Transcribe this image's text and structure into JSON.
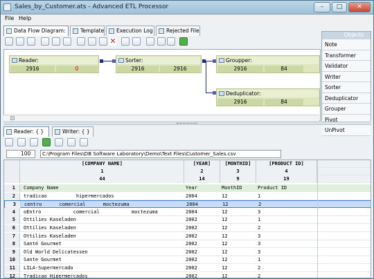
{
  "window": {
    "title": "Sales_by_Customer.ats - Advanced ETL Processor",
    "minimize": "–",
    "maximize": "□",
    "close": "✕"
  },
  "menu": {
    "file": "File",
    "help": "Help"
  },
  "tabs_top": [
    "Data Flow Diagram:",
    "Template",
    "Execution Log",
    "Rejected File"
  ],
  "objects_panel": {
    "title": "Objects",
    "items": [
      "Note",
      "Transformer",
      "Validator",
      "Writer",
      "Sorter",
      "Deduplicator",
      "Grouper",
      "Pivot",
      "UnPivot"
    ]
  },
  "nodes": {
    "reader": {
      "label": "Reader:",
      "v1": "2916",
      "v2": "0"
    },
    "sorter": {
      "label": "Sorter:",
      "v1": "2916",
      "v2": "2916"
    },
    "groupper": {
      "label": "Groupper:",
      "v1": "2916",
      "v2": "84"
    },
    "deduplicator": {
      "label": "Deduplicator:",
      "v1": "2916",
      "v2": "84"
    }
  },
  "tabs_bottom": [
    "Reader: { }",
    "Writer: { }"
  ],
  "pathbar": {
    "zoom": "100",
    "path": "C:\\Program Files\\DB Software Laboratory\\Demo\\Text Files\\Customer_Sales.csv"
  },
  "grid": {
    "columns": [
      {
        "name": "[COMPANY NAME]",
        "index": "1",
        "width": "44"
      },
      {
        "name": "[YEAR]",
        "index": "2",
        "width": "14"
      },
      {
        "name": "[MONTHID]",
        "index": "3",
        "width": "9"
      },
      {
        "name": "[PRODUCT ID]",
        "index": "4",
        "width": "19"
      }
    ],
    "rows": [
      {
        "n": "1",
        "c": "Company Name",
        "y": "Year",
        "m": "MonthID",
        "p": "Product ID"
      },
      {
        "n": "2",
        "c": "tradicao          hipermercados",
        "y": "2004",
        "m": "12",
        "p": "1"
      },
      {
        "n": "3",
        "c": "centro      comercial      moctezuma",
        "y": "2004",
        "m": "12",
        "p": "2"
      },
      {
        "n": "4",
        "c": "oEntro           comercial           moctezuma",
        "y": "2004",
        "m": "12",
        "p": "3"
      },
      {
        "n": "5",
        "c": "Ottilies Kaseladen",
        "y": "2002",
        "m": "12",
        "p": "1"
      },
      {
        "n": "6",
        "c": "Ottilies Kaseladen",
        "y": "2002",
        "m": "12",
        "p": "2"
      },
      {
        "n": "7",
        "c": "Ottilies Kaseladen",
        "y": "2002",
        "m": "12",
        "p": "3"
      },
      {
        "n": "8",
        "c": "Santé Gourmet",
        "y": "2002",
        "m": "12",
        "p": "3"
      },
      {
        "n": "9",
        "c": "Old World Delicatessen",
        "y": "2002",
        "m": "12",
        "p": "3"
      },
      {
        "n": "10",
        "c": "Sante Gourmet",
        "y": "2002",
        "m": "12",
        "p": "1"
      },
      {
        "n": "11",
        "c": "LILA-Supermercado",
        "y": "2002",
        "m": "12",
        "p": "2"
      },
      {
        "n": "12",
        "c": "Tradicao Hipermercados",
        "y": "2002",
        "m": "12",
        "p": "2"
      }
    ]
  }
}
